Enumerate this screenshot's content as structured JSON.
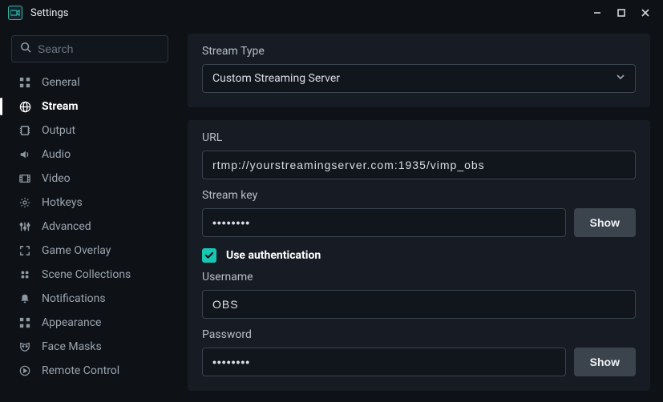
{
  "window": {
    "title": "Settings"
  },
  "search": {
    "placeholder": "Search"
  },
  "sidebar": {
    "items": [
      {
        "label": "General"
      },
      {
        "label": "Stream"
      },
      {
        "label": "Output"
      },
      {
        "label": "Audio"
      },
      {
        "label": "Video"
      },
      {
        "label": "Hotkeys"
      },
      {
        "label": "Advanced"
      },
      {
        "label": "Game Overlay"
      },
      {
        "label": "Scene Collections"
      },
      {
        "label": "Notifications"
      },
      {
        "label": "Appearance"
      },
      {
        "label": "Face Masks"
      },
      {
        "label": "Remote Control"
      }
    ],
    "active_index": 1
  },
  "stream": {
    "type_label": "Stream Type",
    "type_value": "Custom Streaming Server",
    "url_label": "URL",
    "url_value": "rtmp://yourstreamingserver.com:1935/vimp_obs",
    "key_label": "Stream key",
    "key_value": "••••••••",
    "show_label": "Show",
    "use_auth_label": "Use authentication",
    "use_auth_checked": true,
    "username_label": "Username",
    "username_value": "OBS",
    "password_label": "Password",
    "password_value": "••••••••"
  }
}
